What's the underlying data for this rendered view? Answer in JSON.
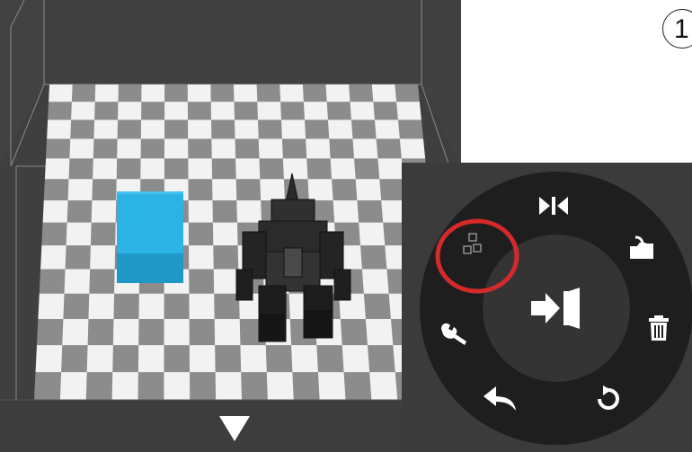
{
  "step": {
    "number": "1"
  },
  "menu": {
    "items": [
      {
        "icon": "mirror-icon",
        "label": ""
      },
      {
        "icon": "import-folder-icon",
        "label": ""
      },
      {
        "icon": "trash-icon",
        "label": ""
      },
      {
        "icon": "rotate-icon",
        "label": ""
      },
      {
        "icon": "undo-arrow-icon",
        "label": ""
      },
      {
        "icon": "wrench-icon",
        "label": ""
      },
      {
        "icon": "arrange-blocks-icon",
        "label": "",
        "highlighted": true
      }
    ],
    "center": {
      "icon": "exit-door-icon"
    }
  },
  "colors": {
    "background": "#3f3f3f",
    "menu_ring": "#1e1e1e",
    "menu_center": "#343434",
    "highlight_ring": "#d42a2a",
    "cube": "#2ab3e4",
    "checker_light": "#f2f2f2",
    "checker_dark": "#8c8c8c"
  },
  "scene": {
    "objects": [
      "blue-cube",
      "robot-model"
    ]
  }
}
